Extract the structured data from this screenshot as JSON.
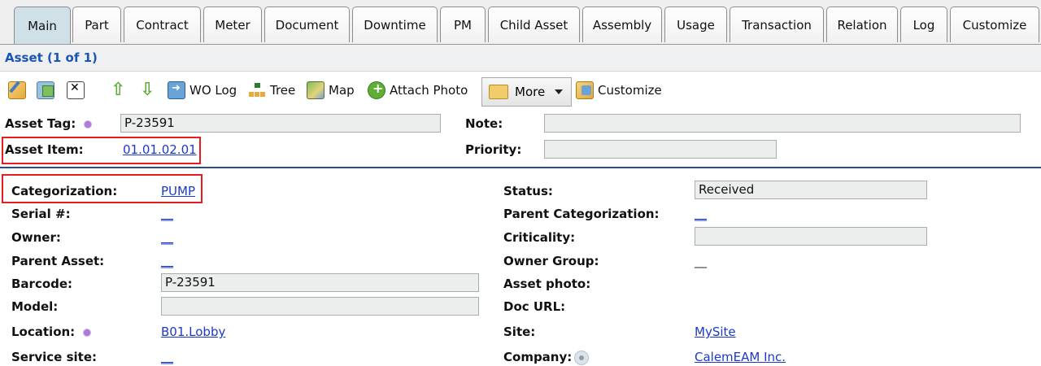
{
  "tabs": [
    "Main",
    "Part",
    "Contract",
    "Meter",
    "Document",
    "Downtime",
    "PM",
    "Child Asset",
    "Assembly",
    "Usage",
    "Transaction",
    "Relation",
    "Log",
    "Customize"
  ],
  "header": {
    "title": "Asset (1 of 1)"
  },
  "toolbar": {
    "edit_icon": "edit-icon",
    "copy_icon": "copy-icon",
    "delete_icon": "delete-icon",
    "up_arrow": "⇧",
    "down_arrow": "⇩",
    "wo_log_label": "WO Log",
    "tree_label": "Tree",
    "map_label": "Map",
    "attach_photo_label": "Attach Photo",
    "more_label": "More",
    "customize_label": "Customize"
  },
  "top_form": {
    "asset_tag_label": "Asset Tag:",
    "asset_tag_value": "P-23591",
    "note_label": "Note:",
    "note_value": "",
    "asset_item_label": "Asset Item:",
    "asset_item_value": "01.01.02.01",
    "priority_label": "Priority:",
    "priority_value": ""
  },
  "details": {
    "categorization_label": "Categorization:",
    "categorization_value": "PUMP",
    "serial_label": "Serial #:",
    "serial_value": "__",
    "owner_label": "Owner:",
    "owner_value": "__",
    "parent_asset_label": "Parent Asset:",
    "parent_asset_value": "__",
    "barcode_label": "Barcode:",
    "barcode_value": "P-23591",
    "model_label": "Model:",
    "model_value": "",
    "location_label": "Location:",
    "location_value": "B01.Lobby",
    "service_site_label": "Service site:",
    "service_site_value": "__",
    "status_label": "Status:",
    "status_value": "Received",
    "parent_categorization_label": "Parent Categorization:",
    "parent_categorization_value": "__",
    "criticality_label": "Criticality:",
    "criticality_value": "",
    "owner_group_label": "Owner Group:",
    "owner_group_value": "__",
    "asset_photo_label": "Asset photo:",
    "doc_url_label": "Doc URL:",
    "site_label": "Site:",
    "site_value": "MySite",
    "company_label": "Company:",
    "company_value": "CalemEAM Inc."
  },
  "colors": {
    "link": "#1d39c9",
    "header_text": "#1a55b5",
    "highlight_box": "#e41e1e",
    "active_tab": "#cfe1e6",
    "divider": "#2a4f86"
  }
}
